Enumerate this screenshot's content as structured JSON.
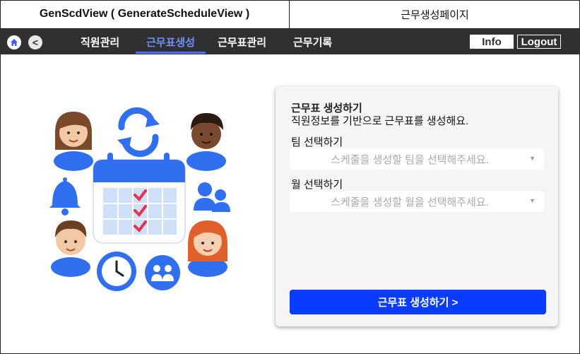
{
  "header": {
    "left_title": "GenScdView ( GenerateScheduleView )",
    "right_title": "근무생성페이지"
  },
  "nav": {
    "back_label": "<",
    "items": [
      {
        "label": "직원관리",
        "active": false
      },
      {
        "label": "근무표생성",
        "active": true
      },
      {
        "label": "근무표관리",
        "active": false
      },
      {
        "label": "근무기록",
        "active": false
      }
    ],
    "info_label": "Info",
    "logout_label": "Logout"
  },
  "form": {
    "title": "근무표 생성하기",
    "description": "직원정보를 기반으로 근무표를 생성해요.",
    "team": {
      "label": "팀 선택하기",
      "placeholder": "스케줄을 생성할 팀을 선택해주세요."
    },
    "month": {
      "label": "월 선택하기",
      "placeholder": "스케줄을 생성할 월을 선택해주세요."
    },
    "submit_label": "근무표 생성하기 >"
  },
  "colors": {
    "nav_background": "#303030",
    "nav_active": "#6f8dff",
    "primary_button": "#0a3cff",
    "illustration_blue": "#2f6ff0"
  }
}
